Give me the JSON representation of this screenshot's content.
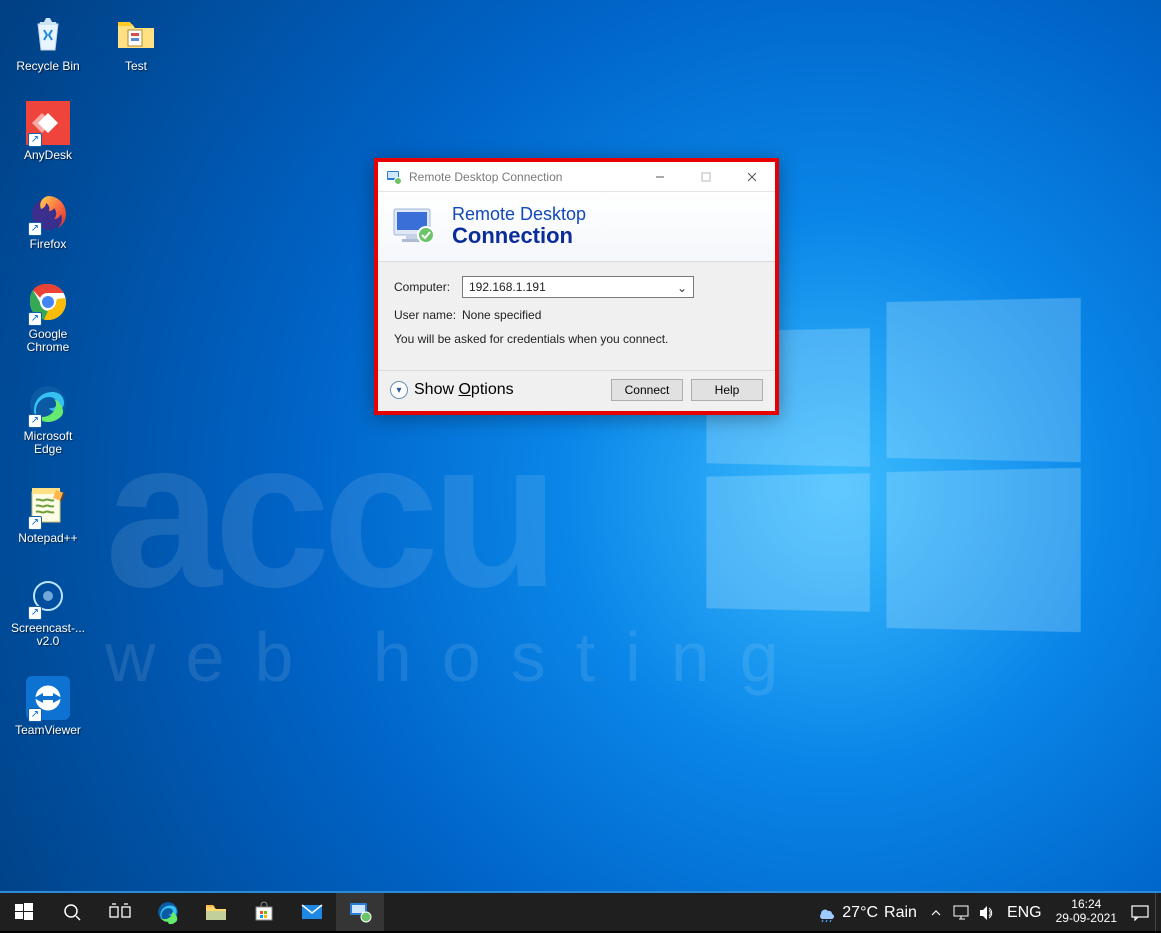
{
  "desktop_icons_col1": [
    {
      "id": "recycle-bin",
      "label": "Recycle Bin"
    },
    {
      "id": "anydesk",
      "label": "AnyDesk"
    },
    {
      "id": "firefox",
      "label": "Firefox"
    },
    {
      "id": "google-chrome",
      "label": "Google Chrome"
    },
    {
      "id": "microsoft-edge",
      "label": "Microsoft Edge"
    },
    {
      "id": "notepadpp",
      "label": "Notepad++"
    },
    {
      "id": "screencast",
      "label": "Screencast-... v2.0"
    },
    {
      "id": "teamviewer",
      "label": "TeamViewer"
    }
  ],
  "desktop_icons_col2": [
    {
      "id": "test-folder",
      "label": "Test"
    }
  ],
  "watermark": {
    "big": "accu",
    "sub": "web hosting"
  },
  "dialog": {
    "title": "Remote Desktop Connection",
    "banner_line1": "Remote Desktop",
    "banner_line2": "Connection",
    "computer_label": "Computer:",
    "computer_value": "192.168.1.191",
    "username_label": "User name:",
    "username_value": "None specified",
    "hint": "You will be asked for credentials when you connect.",
    "show_options": "Show Options",
    "connect": "Connect",
    "help": "Help"
  },
  "taskbar": {
    "weather_temp": "27°C",
    "weather_cond": "Rain",
    "lang": "ENG",
    "time": "16:24",
    "date": "29-09-2021"
  }
}
